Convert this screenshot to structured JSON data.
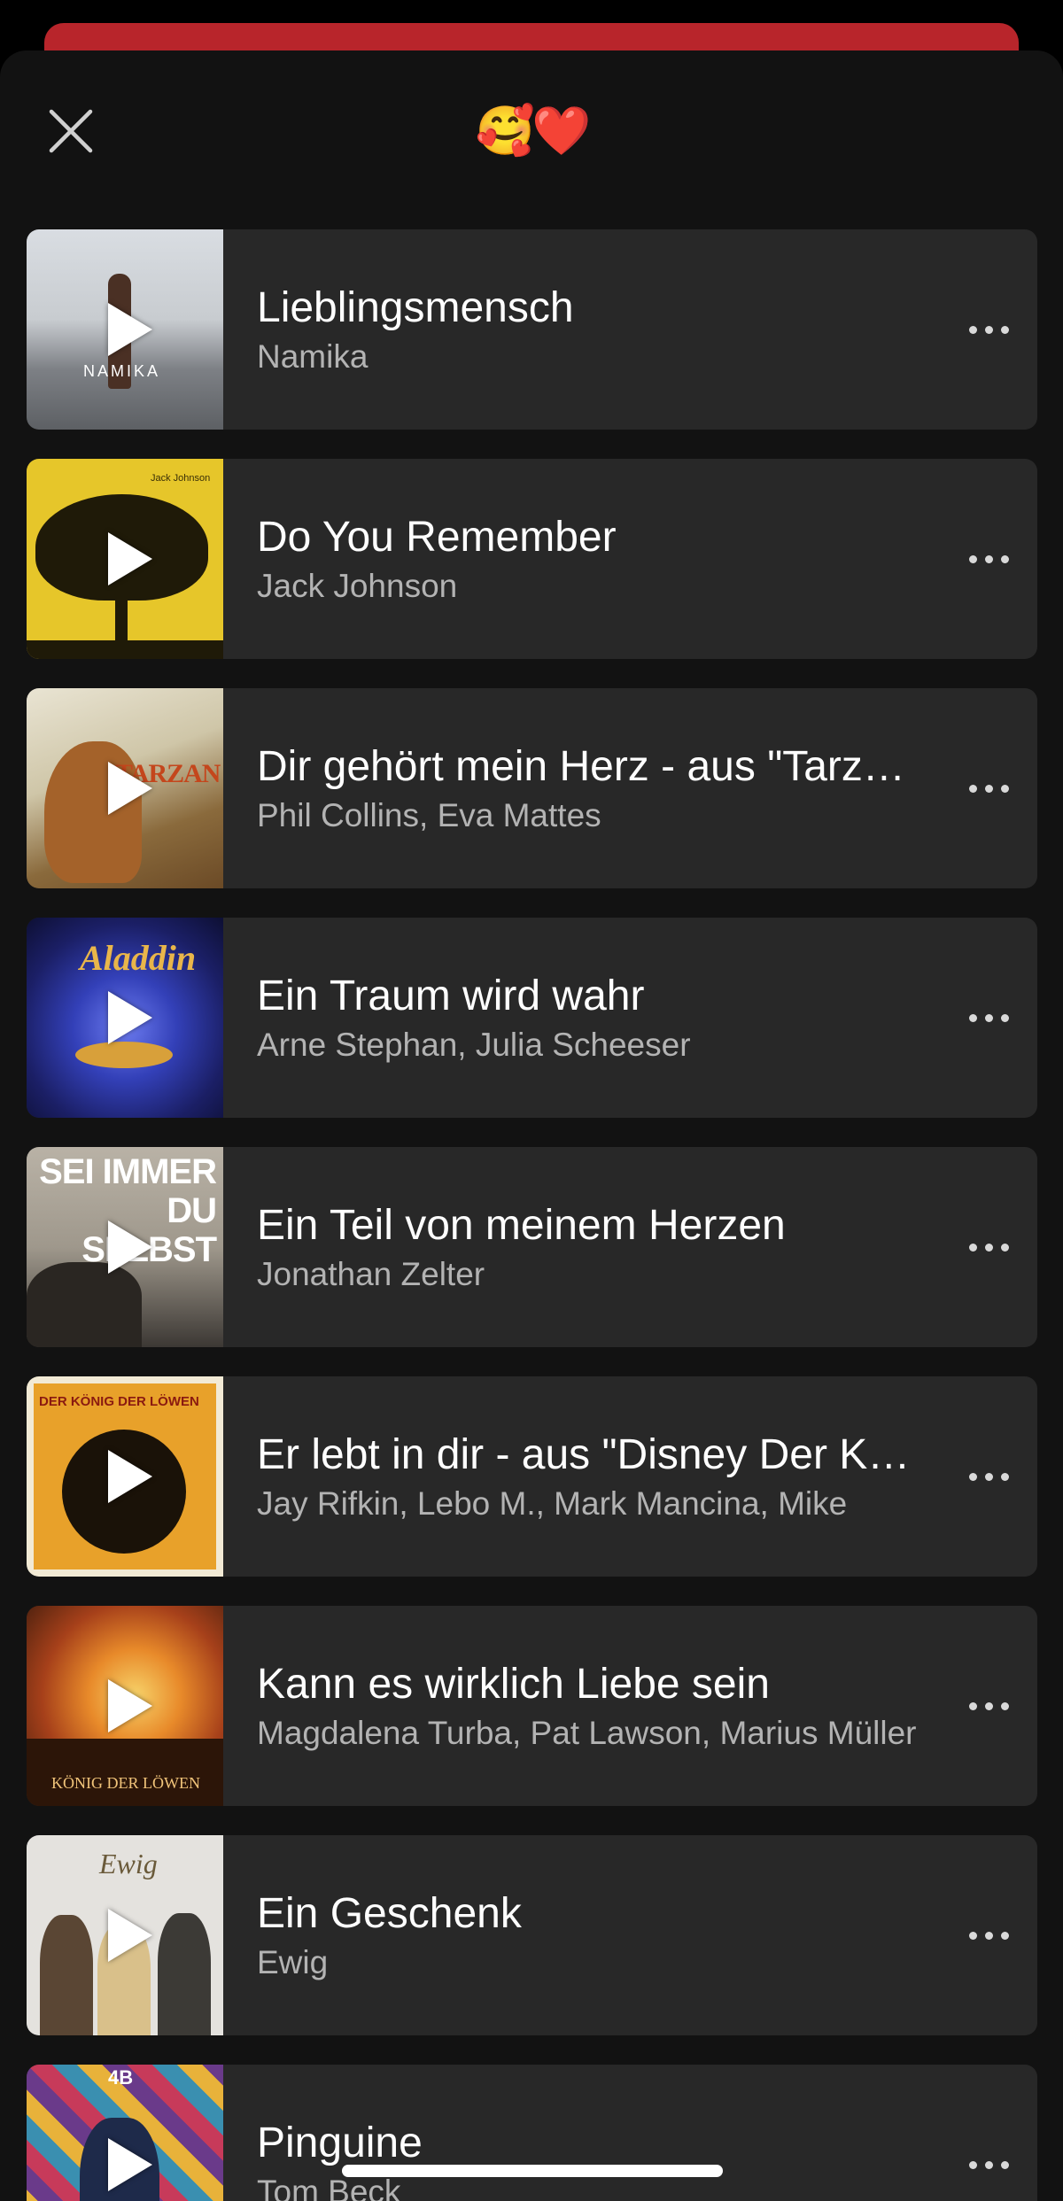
{
  "header": {
    "title": "🥰❤️"
  },
  "tracks": [
    {
      "title": "Lieblingsmensch",
      "artist": "Namika",
      "art": "namika",
      "art_label": "NAMIKA"
    },
    {
      "title": "Do You Remember",
      "artist": "Jack Johnson",
      "art": "tree",
      "art_label": "Jack Johnson"
    },
    {
      "title": "Dir gehört mein Herz - aus \"Tarzan\"",
      "artist": "Phil Collins, Eva Mattes",
      "art": "tarzan",
      "art_label": "TARZAN"
    },
    {
      "title": "Ein Traum wird wahr",
      "artist": "Arne Stephan, Julia Scheeser",
      "art": "aladdin",
      "art_label": "Aladdin"
    },
    {
      "title": "Ein Teil von meinem Herzen",
      "artist": "Jonathan Zelter",
      "art": "zelter",
      "art_label": "SEI IMMER DU SELBST"
    },
    {
      "title": "Er lebt in dir - aus \"Disney Der König der Löwen\"",
      "artist": "Jay Rifkin, Lebo M., Mark Mancina, Mike",
      "art": "lionking",
      "art_label": "DER KÖNIG DER LÖWEN"
    },
    {
      "title": "Kann es wirklich Liebe sein",
      "artist": "Magdalena Turba, Pat Lawson, Marius Müller",
      "art": "sunset",
      "art_label": "KÖNIG DER LÖWEN"
    },
    {
      "title": "Ein Geschenk",
      "artist": "Ewig",
      "art": "ewig",
      "art_label": "Ewig"
    },
    {
      "title": "Pinguine",
      "artist": "Tom Beck",
      "art": "pinguine",
      "art_label": "4B"
    }
  ],
  "colors": {
    "background": "#121212",
    "row": "#282828",
    "banner": "#b8252b",
    "secondary_text": "#b3b3b3"
  },
  "icons": {
    "close": "close-icon",
    "play": "play-icon",
    "more": "more-options-icon"
  }
}
